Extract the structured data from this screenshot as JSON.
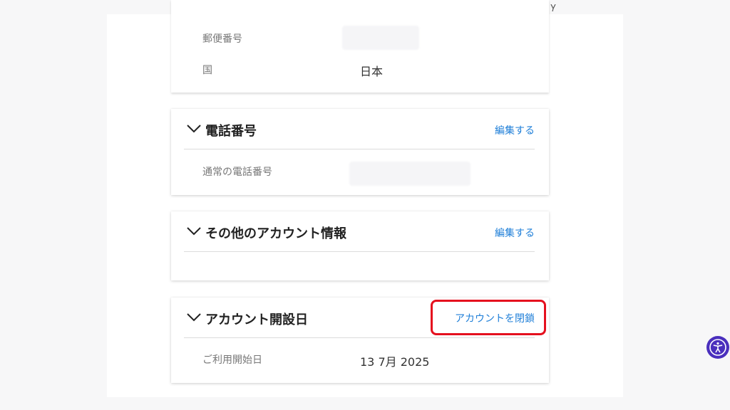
{
  "address_card": {
    "rows": [
      {
        "label": "郵便番号",
        "value": ""
      },
      {
        "label": "国",
        "value": "日本"
      }
    ]
  },
  "phone_card": {
    "title": "電話番号",
    "edit_label": "編集する",
    "rows": [
      {
        "label": "通常の電話番号",
        "value": ""
      }
    ]
  },
  "other_card": {
    "title": "その他のアカウント情報",
    "edit_label": "編集する"
  },
  "opened_card": {
    "title": "アカウント開設日",
    "close_label": "アカウントを閉鎖",
    "rows": [
      {
        "label": "ご利用開始日",
        "value": "13 7月 2025"
      }
    ]
  },
  "colors": {
    "link": "#1f7fd8",
    "highlight": "#e5101e",
    "accessibility": "#4a2fbd"
  },
  "icons": {
    "section_toggle": "chevron-down-icon",
    "accessibility": "accessibility-icon"
  }
}
